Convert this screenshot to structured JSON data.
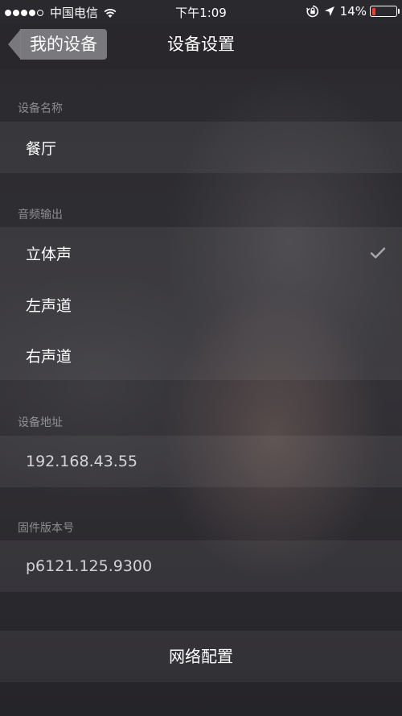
{
  "status_bar": {
    "carrier": "中国电信",
    "time": "下午1:09",
    "battery_percent": "14%",
    "battery_level": 0.14,
    "signal_bars": 4,
    "icons": [
      "wifi-icon",
      "orientation-lock-icon",
      "location-icon",
      "battery-icon"
    ]
  },
  "nav": {
    "back_label": "我的设备",
    "title": "设备设置"
  },
  "sections": {
    "device_name": {
      "header": "设备名称",
      "value": "餐厅"
    },
    "audio_output": {
      "header": "音频输出",
      "options": [
        "立体声",
        "左声道",
        "右声道"
      ],
      "selected": "立体声"
    },
    "device_address": {
      "header": "设备地址",
      "value": "192.168.43.55"
    },
    "firmware": {
      "header": "固件版本号",
      "value": "p6121.125.9300"
    }
  },
  "actions": {
    "network_config": "网络配置"
  },
  "colors": {
    "battery_low": "#ff3b30",
    "back_button_bg": "#828286"
  }
}
